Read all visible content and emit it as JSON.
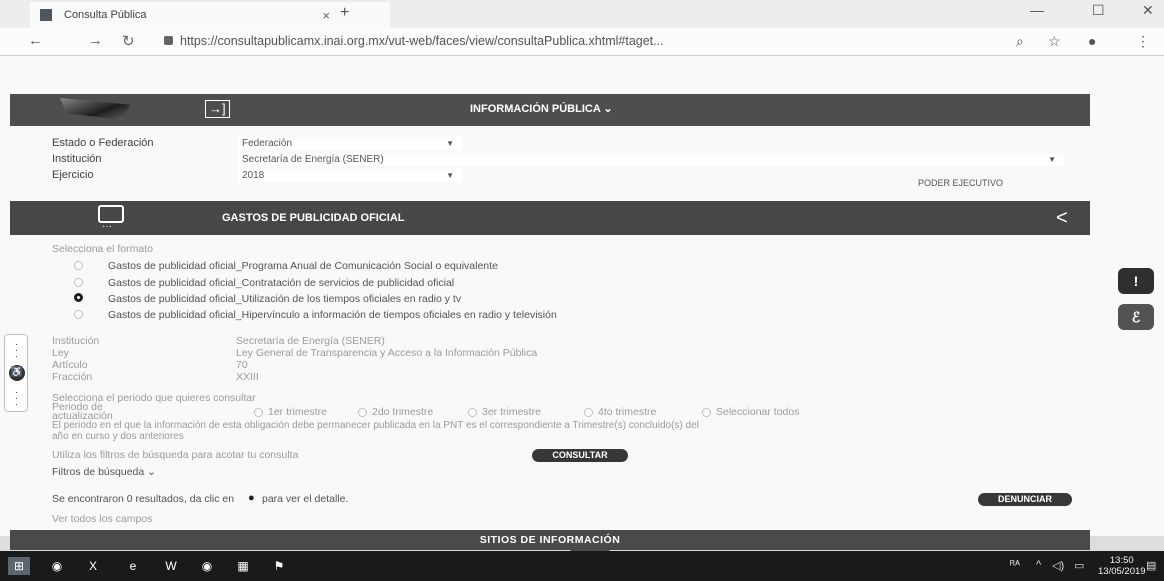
{
  "browser": {
    "tab_title": "Consulta Pública",
    "tab_close": "×",
    "new_tab": "+",
    "url": "https://consultapublicamx.inai.org.mx/vut-web/faces/view/consultaPublica.xhtml#taget...",
    "minimize": "—",
    "maximize": "☐",
    "close": "✕"
  },
  "header": {
    "title": "INFORMACIÓN PÚBLICA ⌄",
    "login_icon": "→]"
  },
  "filters": {
    "estado_label": "Estado o Federación",
    "estado_value": "Federación",
    "institucion_label": "Institución",
    "institucion_value": "Secretaría de Energía (SENER)",
    "ejercicio_label": "Ejercicio",
    "ejercicio_value": "2018",
    "poder": "PODER EJECUTIVO"
  },
  "section": {
    "title": "GASTOS DE PUBLICIDAD OFICIAL"
  },
  "formato": {
    "label": "Selecciona el formato",
    "options": [
      {
        "label": "Gastos de publicidad oficial_Programa Anual de Comunicación Social o equivalente",
        "selected": false
      },
      {
        "label": "Gastos de publicidad oficial_Contratación de servicios de publicidad oficial",
        "selected": false
      },
      {
        "label": "Gastos de publicidad oficial_Utilización de los tiempos oficiales en radio y tv",
        "selected": true
      },
      {
        "label": "Gastos de publicidad oficial_Hipervínculo a información de tiempos oficiales en radio y televisión",
        "selected": false
      }
    ]
  },
  "details": {
    "institucion_label": "Institución",
    "institucion_value": "Secretaría de Energía (SENER)",
    "ley_label": "Ley",
    "ley_value": "Ley General de Transparencia y Acceso a la Información Pública",
    "articulo_label": "Artículo",
    "articulo_value": "70",
    "fraccion_label": "Fracción",
    "fraccion_value": "XXIII"
  },
  "periodo": {
    "prompt": "Selecciona el periodo que quieres consultar",
    "label_line1": "Periodo de",
    "label_line2": "actualización",
    "options": [
      "1er trimestre",
      "2do trimestre",
      "3er trimestre",
      "4to trimestre",
      "Seleccionar todos"
    ],
    "note_line1": "El periodo en el que la información de esta obligación debe permanecer publicada en la PNT es el correspondiente a Trimestre(s) concluido(s) del",
    "note_line2": "año en curso y dos anteriores"
  },
  "busqueda": {
    "hint": "Utiliza los filtros de búsqueda para acotar tu consulta",
    "consultar": "CONSULTAR",
    "filtros": "Filtros de búsqueda ⌄"
  },
  "results": {
    "text_before": "Se encontraron 0 resultados, da clic en",
    "text_after": "para ver el detalle.",
    "denunciar": "DENUNCIAR",
    "ver_todos": "Ver todos los campos"
  },
  "footer": {
    "sitios": "SITIOS DE INFORMACIÓN"
  },
  "taskbar": {
    "time": "13:50",
    "date": "13/05/2019",
    "lang": "ᴿᴬ"
  }
}
